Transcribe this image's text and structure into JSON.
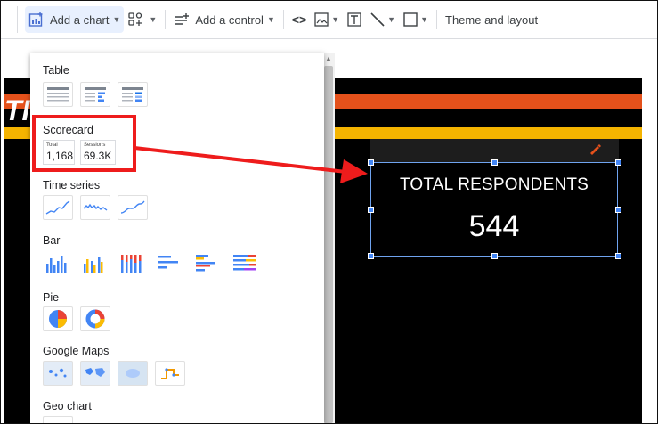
{
  "toolbar": {
    "add_chart_label": "Add a chart",
    "add_control_label": "Add a control",
    "theme_label": "Theme and layout"
  },
  "panel": {
    "sections": {
      "table": "Table",
      "scorecard": "Scorecard",
      "time_series": "Time series",
      "bar": "Bar",
      "pie": "Pie",
      "google_maps": "Google Maps",
      "geo_chart": "Geo chart"
    },
    "scorecard_thumbs": [
      {
        "label": "Total",
        "value": "1,168"
      },
      {
        "label": "Sessions",
        "value": "69.3K"
      }
    ]
  },
  "report": {
    "scorecard_label": "TOTAL RESPONDENTS",
    "scorecard_value": "544",
    "title_fragment": "TI"
  },
  "colors": {
    "accent_blue": "#4285f4",
    "annotation_red": "#ee1c1c",
    "orange_band": "#e4511b",
    "yellow_band": "#f5b400"
  }
}
